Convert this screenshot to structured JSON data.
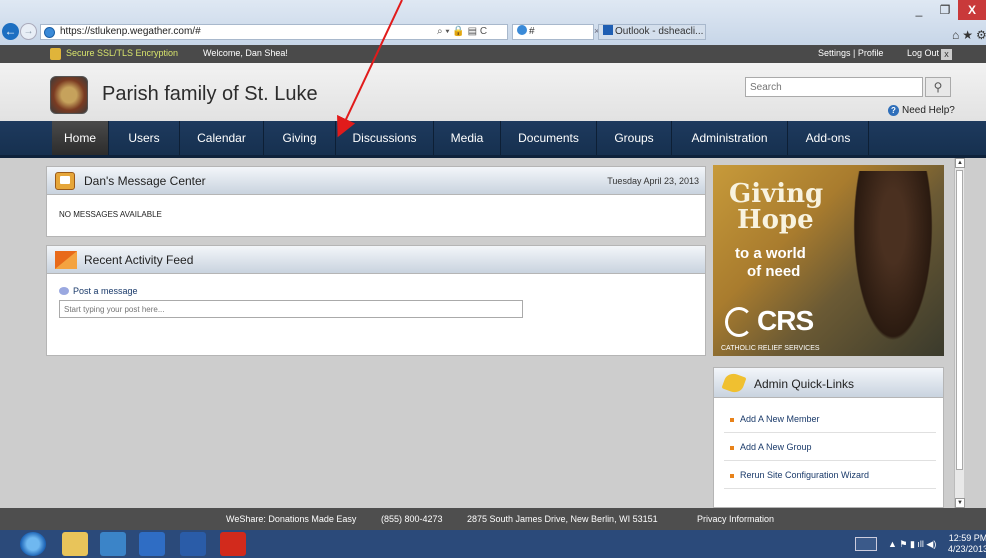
{
  "browser": {
    "url": "https://stlukenp.wegather.com/#",
    "address_icons": "⌕ ▾ 🔒 ▤ C",
    "tab1_label": "#",
    "tab2_label": "Outlook - dsheacli...",
    "tab_close": "×",
    "back": "←",
    "forward": "→",
    "min": "_",
    "max": "❐",
    "close": "X",
    "toolicons": "⌂★⚙"
  },
  "security_bar": {
    "ssl_text": "Secure SSL/TLS Encryption",
    "welcome": "Welcome, Dan Shea!",
    "settings": "Settings | Profile",
    "logout": "Log Out",
    "logout_icon": "x"
  },
  "header": {
    "site_title": "Parish family of St. Luke",
    "search_placeholder": "Search",
    "search_icon": "⚲",
    "help": "Need Help?",
    "help_icon": "?"
  },
  "nav": [
    {
      "label": "Home",
      "active": true
    },
    {
      "label": "Users"
    },
    {
      "label": "Calendar"
    },
    {
      "label": "Giving"
    },
    {
      "label": "Discussions"
    },
    {
      "label": "Media"
    },
    {
      "label": "Documents"
    },
    {
      "label": "Groups"
    },
    {
      "label": "Administration"
    },
    {
      "label": "Add-ons"
    }
  ],
  "message_center": {
    "title": "Dan's Message Center",
    "date": "Tuesday April 23, 2013",
    "empty": "NO MESSAGES AVAILABLE"
  },
  "activity_feed": {
    "title": "Recent Activity Feed",
    "post_label": "Post a message",
    "post_placeholder": "Start typing your post here..."
  },
  "ad": {
    "line1": "Giving",
    "line2": "Hope",
    "line3": "to a world",
    "line4": "of need",
    "brand": "CRS",
    "tagline": "CATHOLIC RELIEF SERVICES"
  },
  "quick_links": {
    "title": "Admin Quick-Links",
    "items": [
      "Add A New Member",
      "Add A New Group",
      "Rerun Site Configuration Wizard"
    ]
  },
  "footer": {
    "tagline": "WeShare: Donations Made Easy",
    "phone": "(855) 800-4273",
    "address": "2875 South James Drive, New Berlin, WI 53151",
    "privacy": "Privacy Information"
  },
  "taskbar": {
    "time": "12:59 PM",
    "date": "4/23/2013",
    "tray_icons": "▲ ⚑ ▮ ıll ◀)"
  },
  "scroll": {
    "up": "▲",
    "down": "▼"
  },
  "colors": {
    "nav_bg": "#1e3a5e",
    "annotation_arrow": "#e11b1b",
    "ssl_text": "#d8e46c"
  }
}
